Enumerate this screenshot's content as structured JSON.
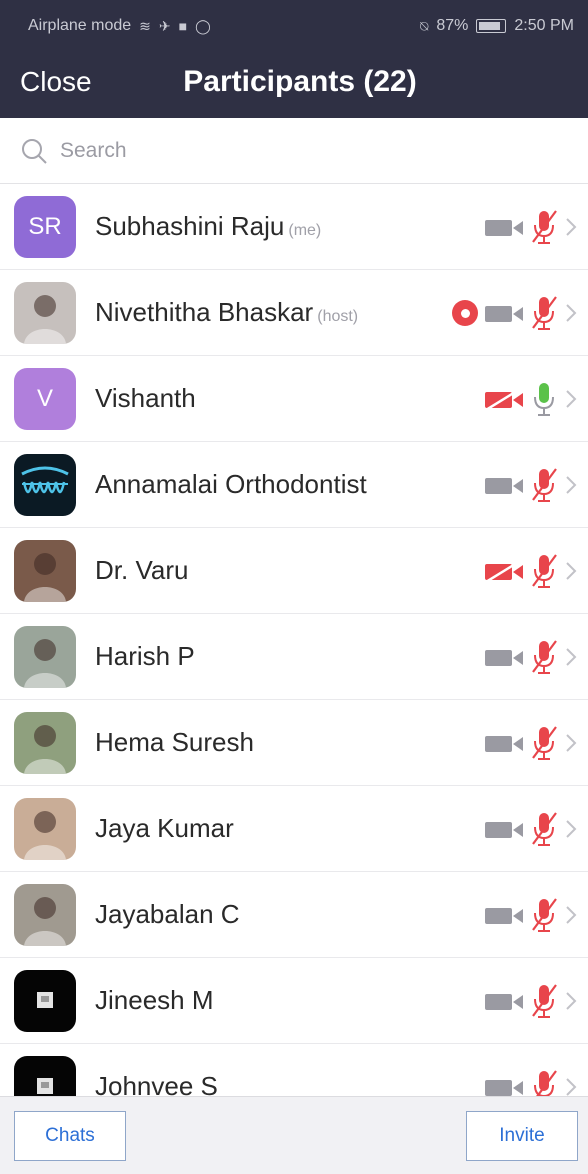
{
  "status_bar": {
    "left_text": "Airplane mode",
    "right_text": "87%",
    "time": "2:50 PM",
    "battery_level": 0.87
  },
  "header": {
    "close_label": "Close",
    "title": "Participants (22)"
  },
  "search": {
    "placeholder": "Search"
  },
  "participants": [
    {
      "name": "Subhashini Raju",
      "tag": "(me)",
      "avatar_text": "SR",
      "avatar_color": "#8f6bd6",
      "avatar_kind": "initials",
      "video_on": false,
      "video_blocked": false,
      "mic": "muted",
      "recording": false
    },
    {
      "name": "Nivethitha Bhaskar",
      "tag": "(host)",
      "avatar_text": "",
      "avatar_color": "#c6c0bd",
      "avatar_kind": "photo",
      "video_on": false,
      "video_blocked": false,
      "mic": "muted",
      "recording": true
    },
    {
      "name": "Vishanth",
      "tag": "",
      "avatar_text": "V",
      "avatar_color": "#b07fdc",
      "avatar_kind": "initials",
      "video_on": false,
      "video_blocked": true,
      "mic": "on",
      "recording": false
    },
    {
      "name": "Annamalai Orthodontist",
      "tag": "",
      "avatar_text": "",
      "avatar_color": "#0b1a24",
      "avatar_kind": "logo",
      "video_on": false,
      "video_blocked": false,
      "mic": "muted",
      "recording": false
    },
    {
      "name": "Dr. Varu",
      "tag": "",
      "avatar_text": "",
      "avatar_color": "#7a5a4a",
      "avatar_kind": "photo",
      "video_on": false,
      "video_blocked": true,
      "mic": "muted",
      "recording": false
    },
    {
      "name": "Harish P",
      "tag": "",
      "avatar_text": "",
      "avatar_color": "#9aa59a",
      "avatar_kind": "photo",
      "video_on": false,
      "video_blocked": false,
      "mic": "muted",
      "recording": false
    },
    {
      "name": "Hema Suresh",
      "tag": "",
      "avatar_text": "",
      "avatar_color": "#8fa07e",
      "avatar_kind": "photo",
      "video_on": false,
      "video_blocked": false,
      "mic": "muted",
      "recording": false
    },
    {
      "name": "Jaya Kumar",
      "tag": "",
      "avatar_text": "",
      "avatar_color": "#c9ad97",
      "avatar_kind": "photo",
      "video_on": false,
      "video_blocked": false,
      "mic": "muted",
      "recording": false
    },
    {
      "name": "Jayabalan C",
      "tag": "",
      "avatar_text": "",
      "avatar_color": "#a09a90",
      "avatar_kind": "photo",
      "video_on": false,
      "video_blocked": false,
      "mic": "muted",
      "recording": false
    },
    {
      "name": "Jineesh M",
      "tag": "",
      "avatar_text": "",
      "avatar_color": "#050505",
      "avatar_kind": "dark",
      "video_on": false,
      "video_blocked": false,
      "mic": "muted",
      "recording": false
    },
    {
      "name": "Johnvee S",
      "tag": "",
      "avatar_text": "",
      "avatar_color": "#050505",
      "avatar_kind": "dark",
      "video_on": false,
      "video_blocked": false,
      "mic": "muted",
      "recording": false
    }
  ],
  "footer": {
    "chats_label": "Chats",
    "invite_label": "Invite"
  },
  "colors": {
    "header_bg": "#2f3044",
    "muted_red": "#e8454b",
    "mic_on_green": "#5bc24a",
    "link_blue": "#2c6fd6"
  }
}
